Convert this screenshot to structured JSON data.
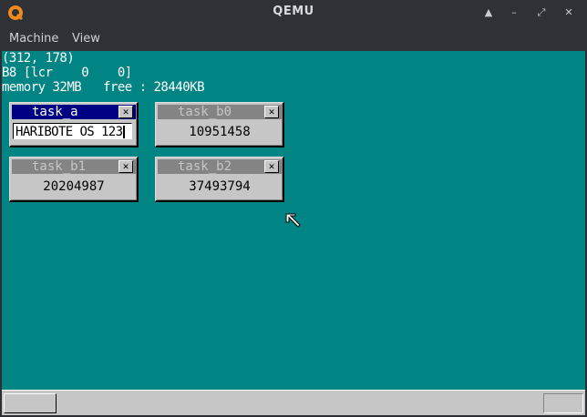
{
  "window": {
    "title": "QEMU",
    "controls": {
      "minimize": "▲",
      "restore": "–",
      "maximize": "⤢",
      "close": "✕"
    }
  },
  "menu": [
    {
      "label": "Machine"
    },
    {
      "label": "View"
    }
  ],
  "screen": {
    "background": "#008484",
    "debug_lines": [
      "(312, 178)",
      "B8 [lcr    0    0]",
      "memory 32MB   free : 28440KB"
    ],
    "windows": [
      {
        "title": "task_a",
        "active": true,
        "input_text": "HARIBOTE OS 123"
      },
      {
        "title": "task_b0",
        "active": false,
        "value": "10951458"
      },
      {
        "title": "task_b1",
        "active": false,
        "value": "20204987"
      },
      {
        "title": "task_b2",
        "active": false,
        "value": "37493794"
      }
    ],
    "close_glyph": "✕"
  },
  "colors": {
    "active_title": "#000084",
    "inactive_title": "#848484",
    "window_face": "#c6c6c6"
  },
  "icons": [
    "qemu-logo-icon",
    "mouse-pointer-icon",
    "close-icon"
  ]
}
